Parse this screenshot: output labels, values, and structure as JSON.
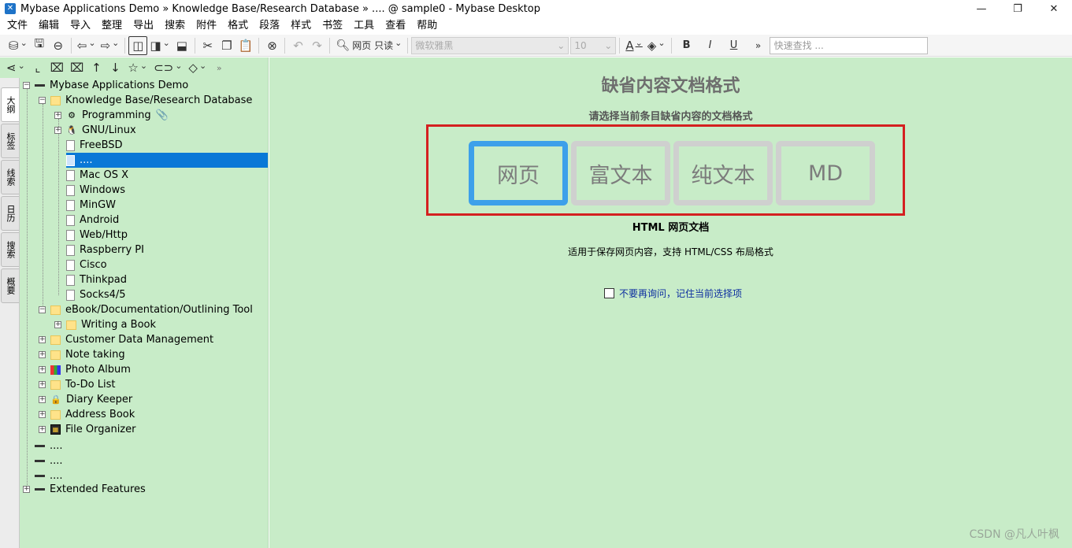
{
  "window": {
    "title": "Mybase Applications Demo » Knowledge Base/Research Database » .... @ sample0 - Mybase Desktop",
    "minimize": "—",
    "restore": "❐",
    "close": "✕"
  },
  "menu": [
    "文件",
    "编辑",
    "导入",
    "整理",
    "导出",
    "搜索",
    "附件",
    "格式",
    "段落",
    "样式",
    "书签",
    "工具",
    "查看",
    "帮助"
  ],
  "toolbar": {
    "view_mode_label": "网页 只读",
    "font_name": "微软雅黑",
    "font_size": "10",
    "quick_search_placeholder": "快速查找 ...",
    "bold": "B",
    "italic": "I",
    "underline": "U",
    "more": "»"
  },
  "side_tabs": [
    "大纲",
    "标签",
    "线索",
    "日历",
    "搜索",
    "概要"
  ],
  "tree": {
    "root": "Mybase Applications Demo",
    "kb": "Knowledge Base/Research Database",
    "programming": "Programming",
    "gnu": "GNU/Linux",
    "freebsd": "FreeBSD",
    "selected": "....",
    "macos": "Mac OS X",
    "windows": "Windows",
    "mingw": "MinGW",
    "android": "Android",
    "webhttp": "Web/Http",
    "raspberry": "Raspberry PI",
    "cisco": "Cisco",
    "thinkpad": "Thinkpad",
    "socks": "Socks4/5",
    "ebook": "eBook/Documentation/Outlining Tool",
    "writing": "Writing a Book",
    "customer": "Customer Data Management",
    "note": "Note taking",
    "photo": "Photo Album",
    "todo": "To-Do List",
    "diary": "Diary Keeper",
    "address": "Address Book",
    "file_org": "File Organizer",
    "dots1": "....",
    "dots2": "....",
    "dots3": "....",
    "extended": "Extended Features"
  },
  "content": {
    "heading": "缺省内容文档格式",
    "subtitle": "请选择当前条目缺省内容的文档格式",
    "formats": [
      "网页",
      "富文本",
      "纯文本",
      "MD"
    ],
    "selected_format_name": "HTML 网页文档",
    "selected_format_desc": "适用于保存网页内容，支持 HTML/CSS 布局格式",
    "remember_label": "不要再询问，记住当前选择项"
  },
  "watermark": "CSDN @凡人叶枫",
  "colors": {
    "panel_green": "#c8ecc8",
    "selection_blue": "#0a78d7",
    "active_format_border": "#3da0ea",
    "annotation_red": "#d42020"
  }
}
